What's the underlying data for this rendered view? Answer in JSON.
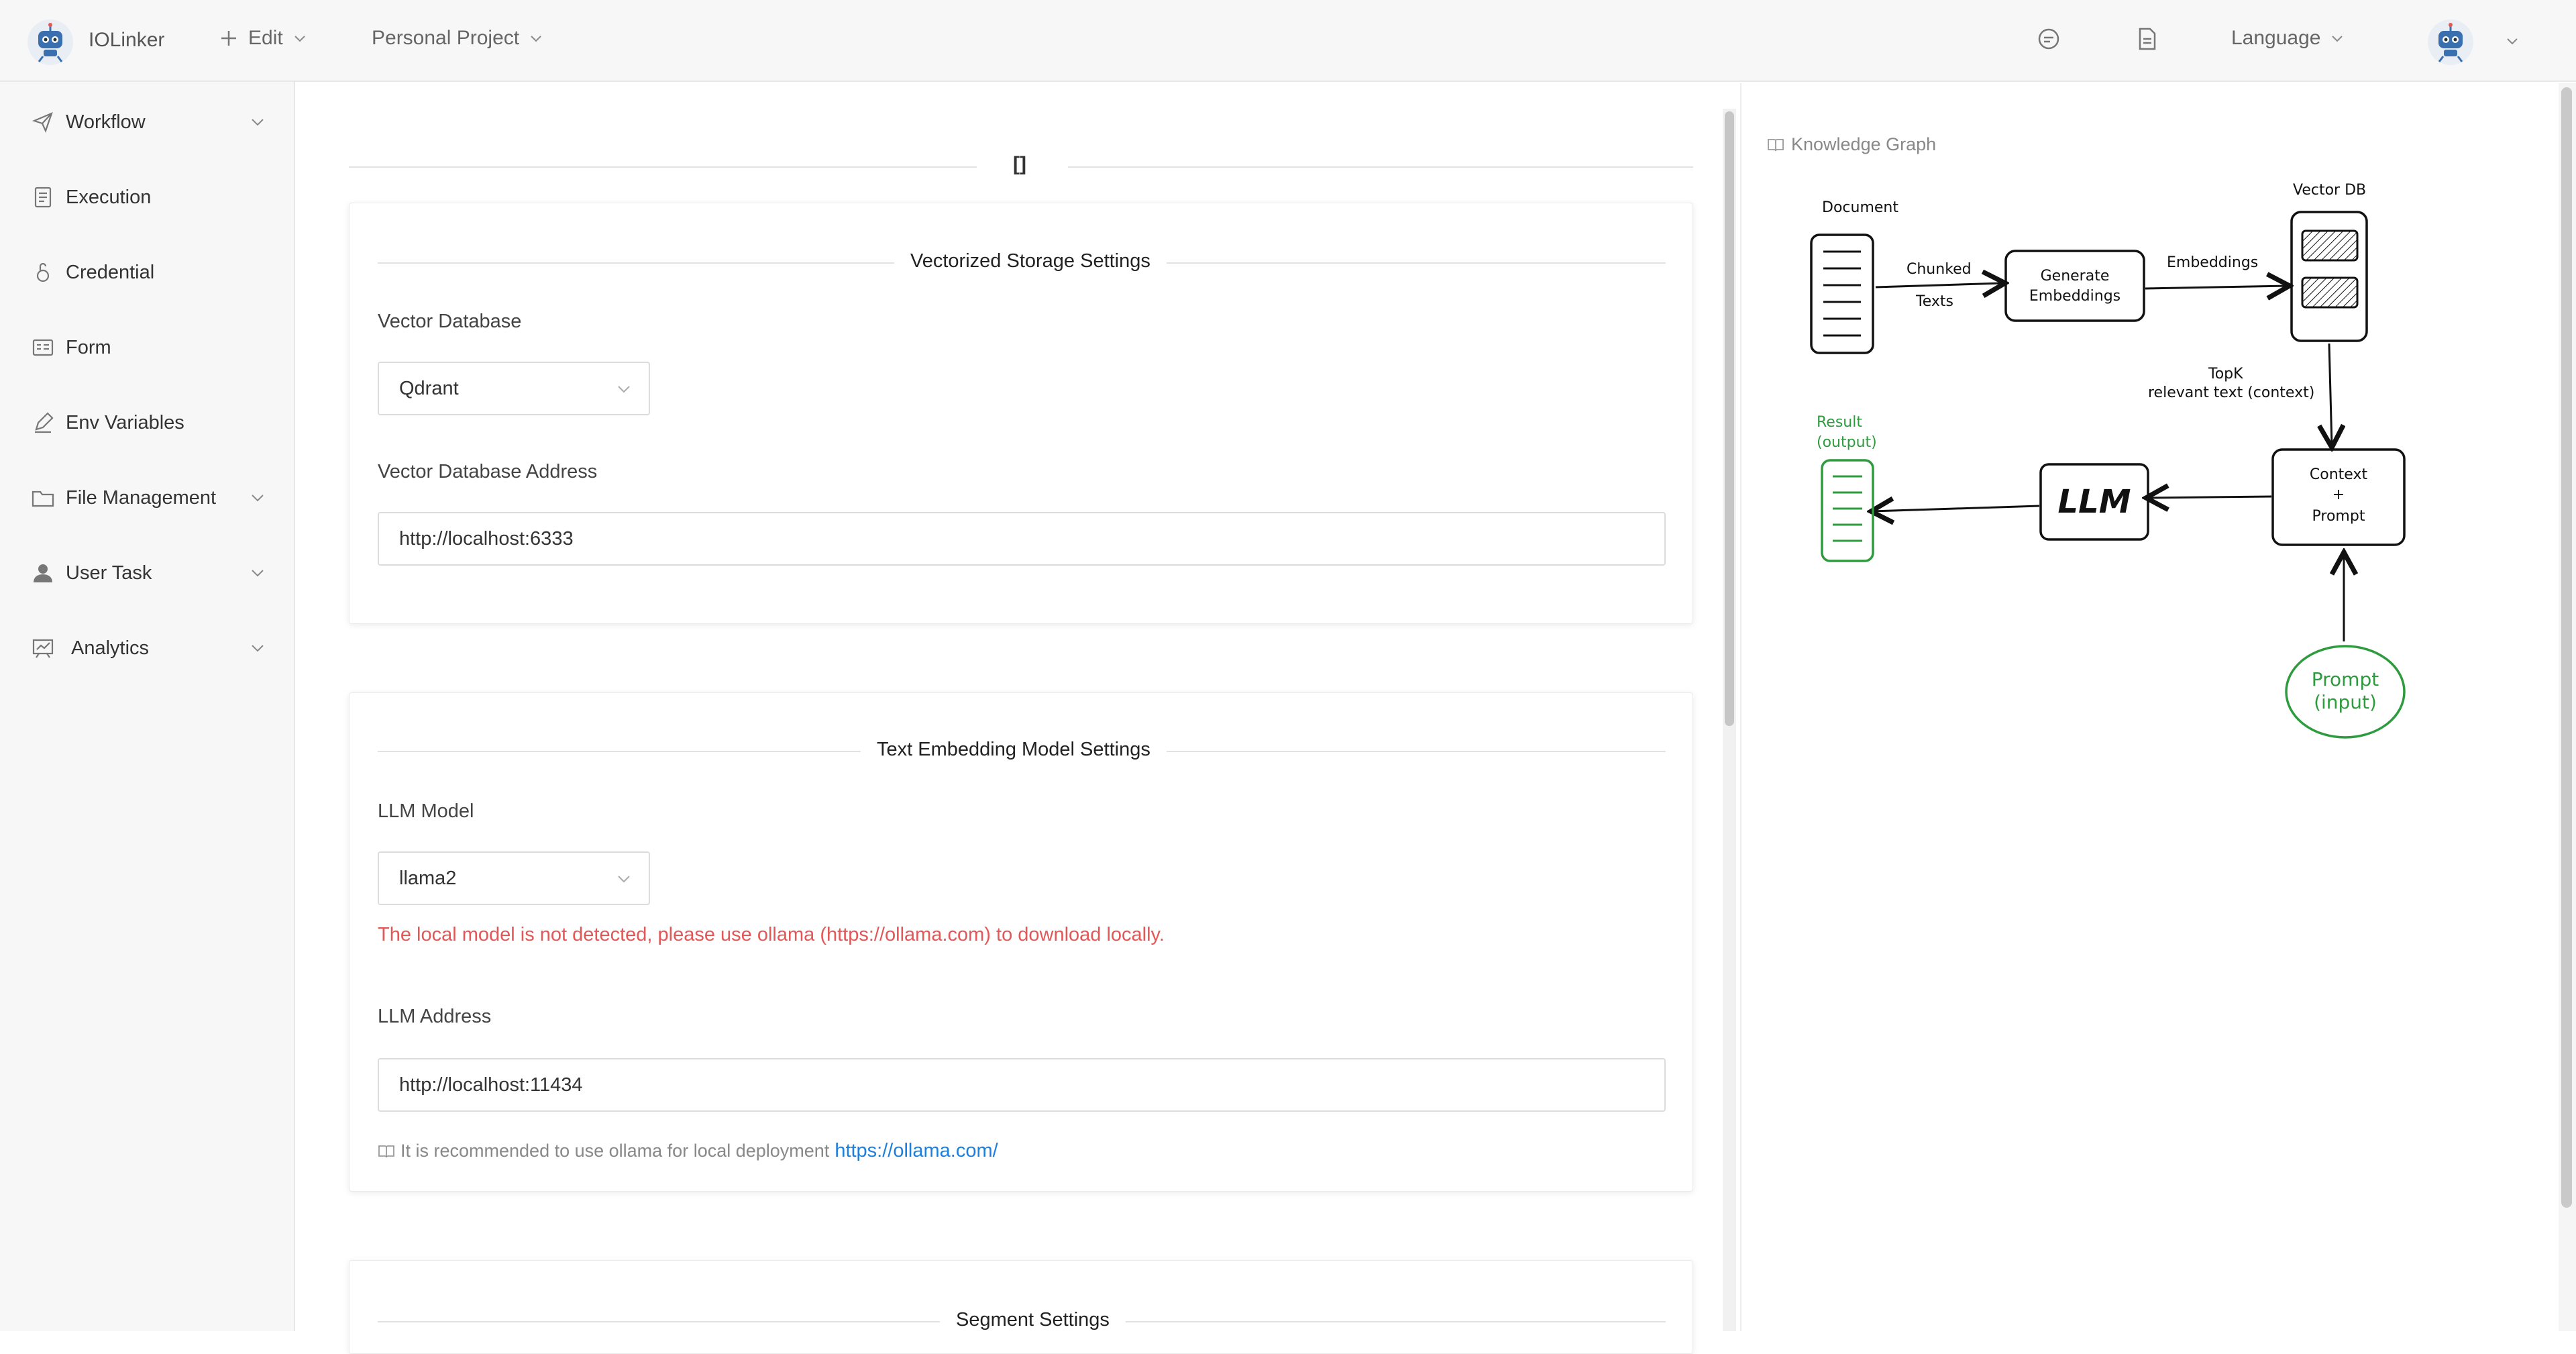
{
  "header": {
    "app_name": "IOLinker",
    "edit_label": "Edit",
    "project_label": "Personal Project",
    "language_label": "Language"
  },
  "sidebar": {
    "items": [
      {
        "label": "Workflow",
        "icon": "send-icon",
        "has_children": true
      },
      {
        "label": "Execution",
        "icon": "document-icon",
        "has_children": false
      },
      {
        "label": "Credential",
        "icon": "lock-icon",
        "has_children": false
      },
      {
        "label": "Form",
        "icon": "form-icon",
        "has_children": false
      },
      {
        "label": "Env Variables",
        "icon": "pen-icon",
        "has_children": false
      },
      {
        "label": "File Management",
        "icon": "folder-icon",
        "has_children": true
      },
      {
        "label": "User Task",
        "icon": "user-icon",
        "has_children": true
      },
      {
        "label": "Analytics",
        "icon": "chart-icon",
        "has_children": true
      }
    ]
  },
  "main": {
    "bracket_title": "[]",
    "vector_card": {
      "title": "Vectorized Storage Settings",
      "db_label": "Vector Database",
      "db_value": "Qdrant",
      "address_label": "Vector Database Address",
      "address_value": "http://localhost:6333"
    },
    "embedding_card": {
      "title": "Text Embedding Model Settings",
      "model_label": "LLM Model",
      "model_value": "llama2",
      "error": "The local model is not detected, please use ollama (https://ollama.com) to download locally.",
      "address_label": "LLM Address",
      "address_value": "http://localhost:11434",
      "hint": "It is recommended to use ollama for local deployment",
      "hint_link": "https://ollama.com/"
    },
    "segment_card": {
      "title": "Segment Settings"
    }
  },
  "knowledge_graph": {
    "title": "Knowledge Graph",
    "diagram": {
      "document": "Document",
      "chunked": "Chunked",
      "texts": "Texts",
      "generate": "Generate",
      "embeddings_box": "Embeddings",
      "embeddings_arrow": "Embeddings",
      "vector_db": "Vector DB",
      "topk": "TopK",
      "relevant": "relevant text (context)",
      "result": "Result",
      "output": "(output)",
      "llm": "LLM",
      "context": "Context",
      "plus": "+",
      "prompt": "Prompt",
      "prompt_input": "Prompt",
      "input": "(input)"
    }
  },
  "colors": {
    "accent_link": "#1b7fe0",
    "error": "#e25757",
    "diagram_green": "#2e9b3e"
  }
}
